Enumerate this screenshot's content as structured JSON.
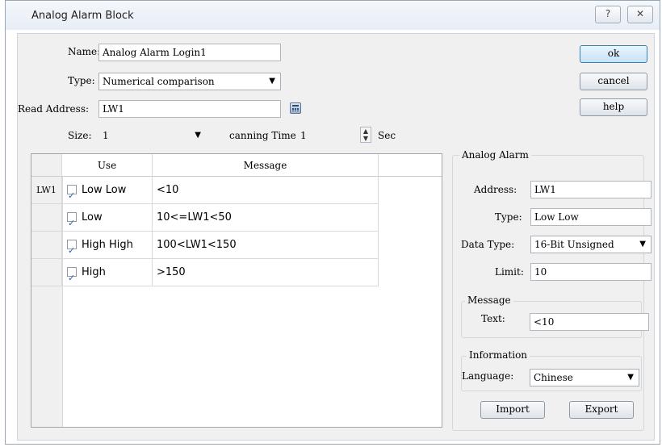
{
  "window": {
    "title": "Analog Alarm Block",
    "help_glyph": "?",
    "close_glyph": "✕"
  },
  "form": {
    "name_label": "Name:",
    "name_value": "Analog Alarm Login1",
    "type_label": "Type:",
    "type_value": "Numerical comparison",
    "read_address_label": "Read Address:",
    "read_address_value": "LW1",
    "size_label": "Size:",
    "size_value": "1",
    "scanning_label": "canning Time:",
    "scanning_value": "1",
    "scanning_unit": "Sec"
  },
  "buttons": {
    "ok": "ok",
    "cancel": "cancel",
    "help": "help",
    "import": "Import",
    "export": "Export"
  },
  "table": {
    "headers": [
      "Use",
      "Message"
    ],
    "rows": [
      {
        "row_label": "LW1",
        "use": "Low Low",
        "checked": true,
        "message": "<10"
      },
      {
        "row_label": "",
        "use": "Low",
        "checked": true,
        "message": "10<=LW1<50"
      },
      {
        "row_label": "",
        "use": "High High",
        "checked": true,
        "message": "100<LW1<150"
      },
      {
        "row_label": "",
        "use": "High",
        "checked": true,
        "message": ">150"
      }
    ]
  },
  "analog_alarm": {
    "group_label": "Analog Alarm",
    "address_label": "Address:",
    "address_value": "LW1",
    "type_label": "Type:",
    "type_value": "Low Low",
    "data_type_label": "Data Type:",
    "data_type_value": "16-Bit Unsigned",
    "limit_label": "Limit:",
    "limit_value": "10",
    "message_group": "Message",
    "text_label": "Text:",
    "text_value": "<10",
    "information_group": "Information",
    "language_label": "Language:",
    "language_value": "Chinese"
  },
  "colors": {
    "default_button_border": "#3c7fb1",
    "checkbox_tick": "#2b5fa6"
  }
}
